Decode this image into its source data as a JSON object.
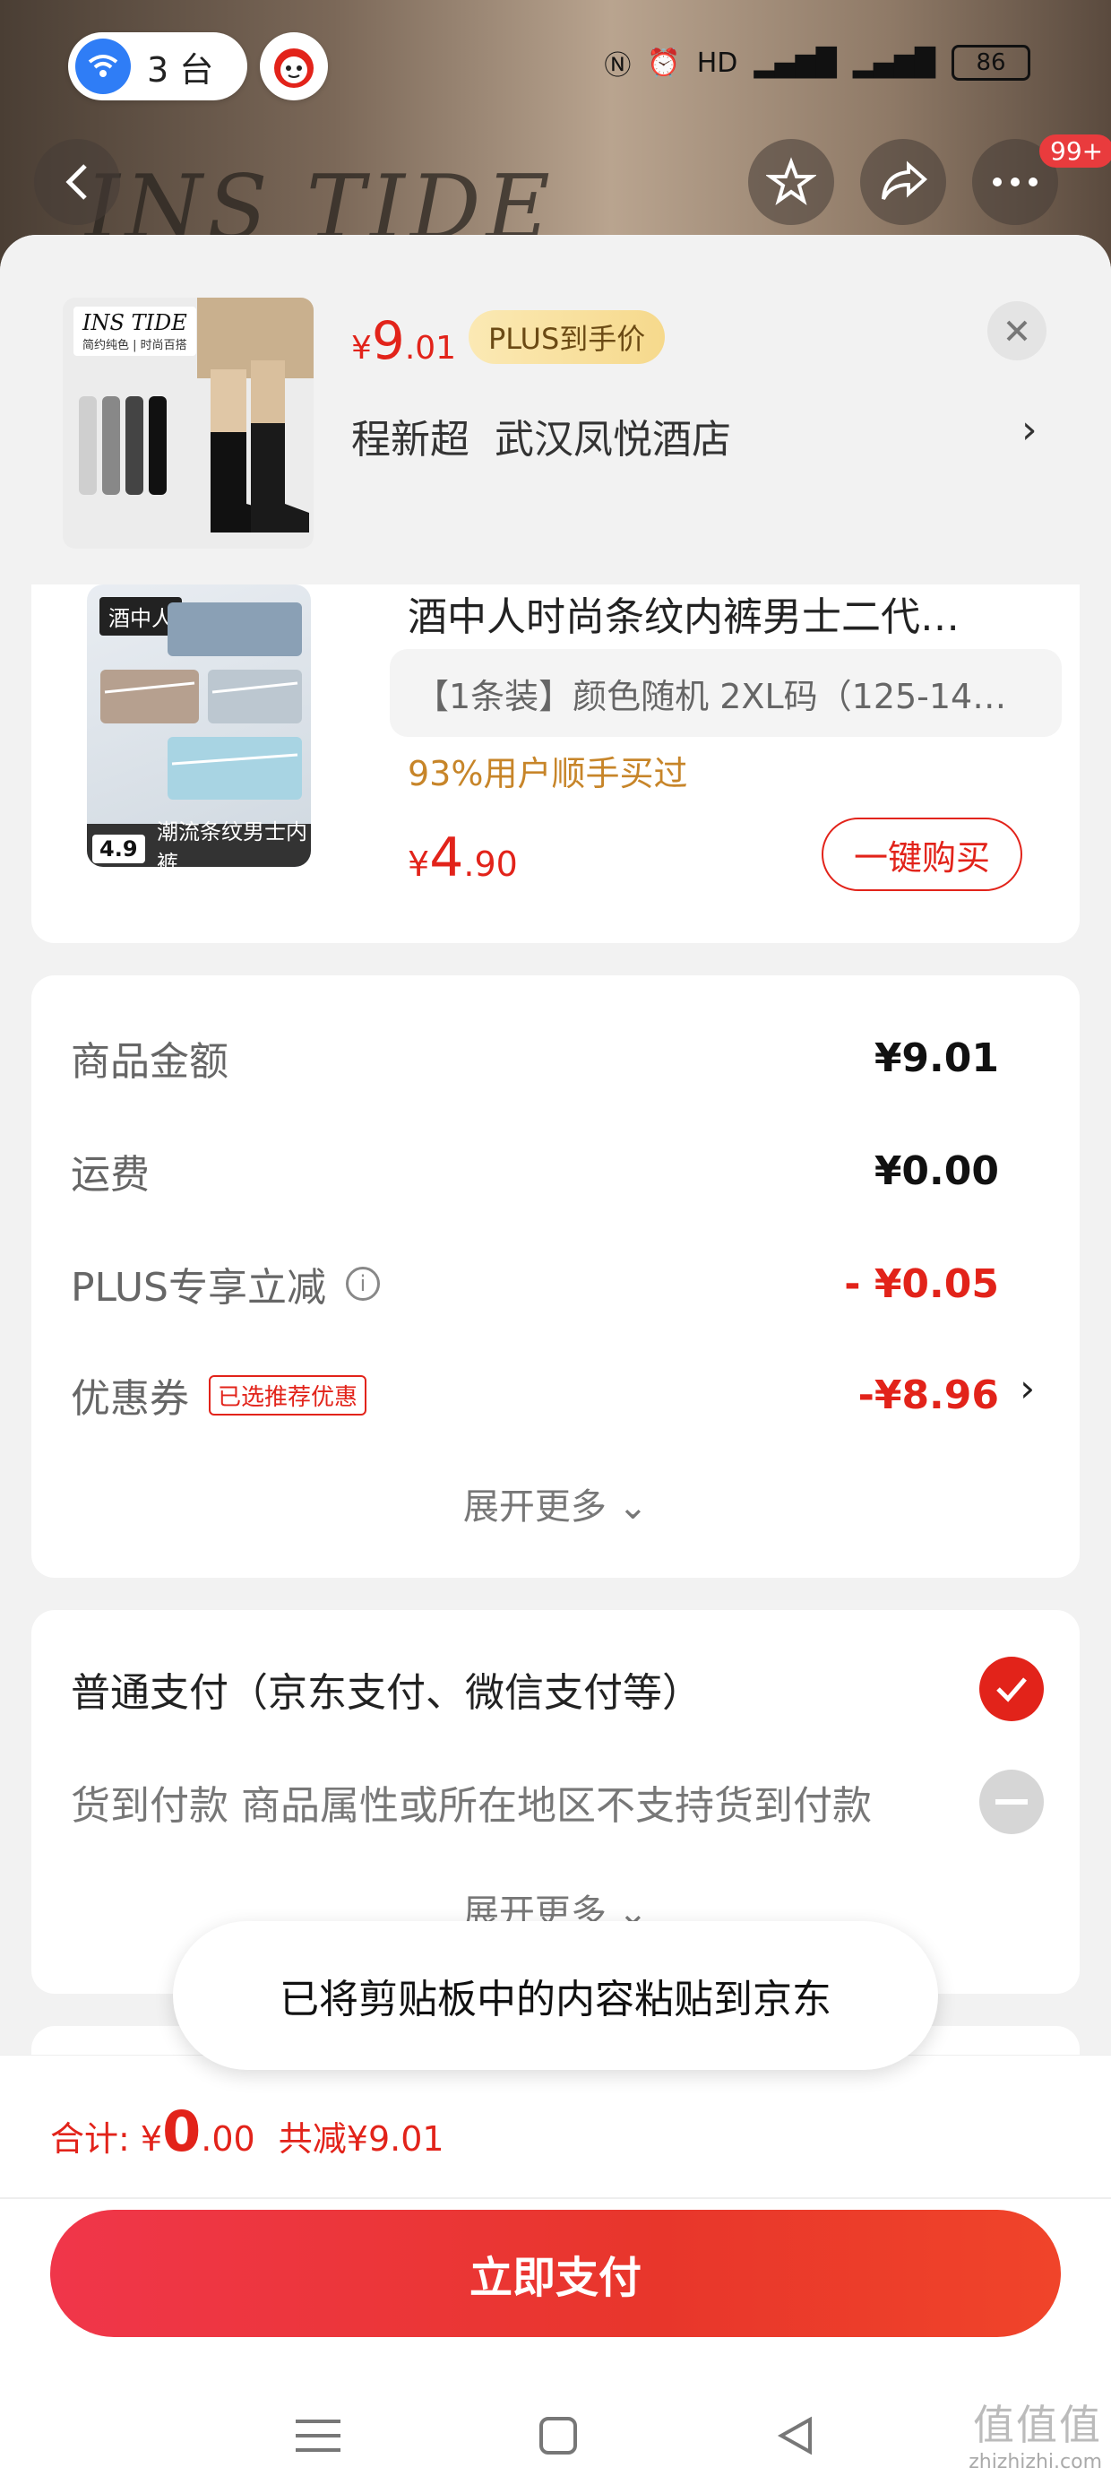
{
  "status_bar": {
    "device_count": "3 台",
    "battery": "86"
  },
  "header": {
    "brand_bg_text": "INS TIDE",
    "badge": "99+",
    "price_symbol": "¥",
    "price_int": "9",
    "price_dec": ".01",
    "plus_tag": "PLUS到手价",
    "address_name": "程新超",
    "address": "武汉凤悦酒店",
    "thumb_brand": "INS TIDE",
    "thumb_sub": "简约纯色 | 时尚百搭"
  },
  "product": {
    "title": "酒中人时尚条纹内裤男士二代…",
    "spec": "【1条装】颜色随机  2XL码（125-14…",
    "sold": "93%用户顺手买过",
    "price_symbol": "¥",
    "price_int": "4",
    "price_dec": ".90",
    "buy_label": "一键购买",
    "img_brand": "酒中人",
    "img_caption": "潮流条纹男士内裤",
    "img_rating": "4.9"
  },
  "summary": {
    "rows": [
      {
        "label": "商品金额",
        "value": "¥9.01"
      },
      {
        "label": "运费",
        "value": "¥0.00"
      },
      {
        "label": "PLUS专享立减",
        "value": "- ¥0.05"
      },
      {
        "label": "优惠券",
        "value": "-¥8.96",
        "tag": "已选推荐优惠"
      }
    ],
    "expand_label": "展开更多"
  },
  "payment": {
    "normal": "普通支付（京东支付、微信支付等）",
    "cod": "货到付款 商品属性或所在地区不支持货到付款",
    "expand_label": "展开更多"
  },
  "toast": "已将剪贴板中的内容粘贴到京东",
  "footer": {
    "total_label": "合计:",
    "total_symbol": "¥",
    "total_int": "0",
    "total_dec": ".00",
    "saved": "共减¥9.01",
    "pay_button": "立即支付"
  },
  "watermark": {
    "main": "值值值",
    "sub": "zhizhizhi.com"
  },
  "colors": {
    "accent": "#e2231a",
    "gold": "#c78529"
  }
}
